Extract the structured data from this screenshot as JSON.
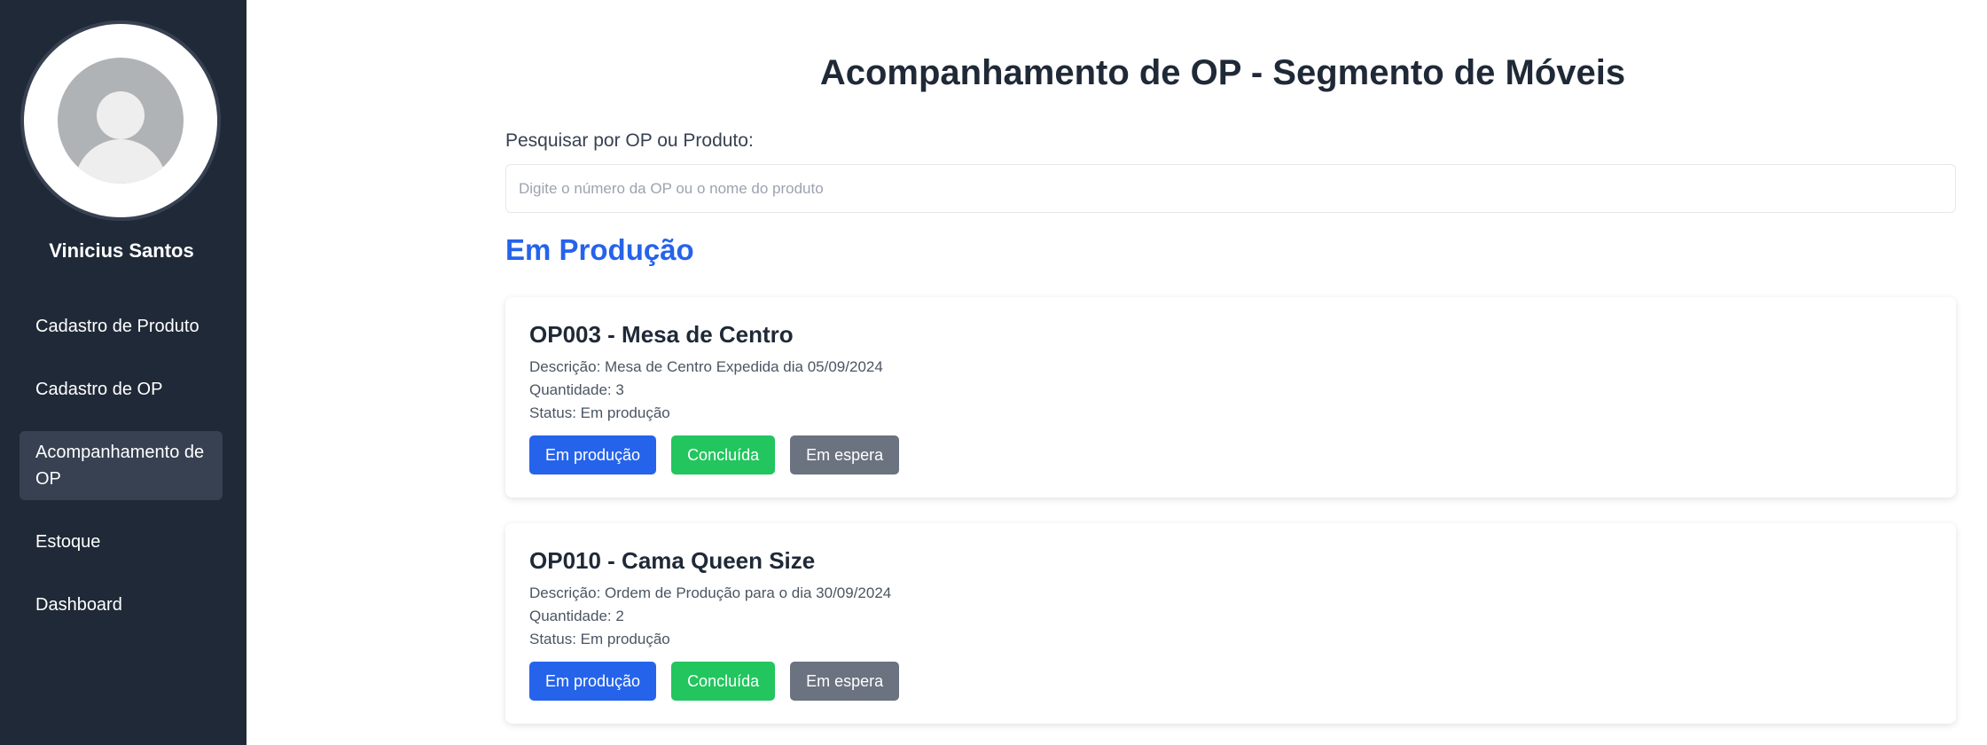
{
  "sidebar": {
    "user_name": "Vinicius Santos",
    "items": [
      {
        "label": "Cadastro de Produto",
        "active": false
      },
      {
        "label": "Cadastro de OP",
        "active": false
      },
      {
        "label": "Acompanhamento de OP",
        "active": true
      },
      {
        "label": "Estoque",
        "active": false
      },
      {
        "label": "Dashboard",
        "active": false
      }
    ]
  },
  "main": {
    "title": "Acompanhamento de OP - Segmento de Móveis",
    "search": {
      "label": "Pesquisar por OP ou Produto:",
      "placeholder": "Digite o número da OP ou o nome do produto",
      "value": ""
    },
    "section_title": "Em Produção",
    "orders": [
      {
        "title": "OP003 - Mesa de Centro",
        "description": "Descrição: Mesa de Centro Expedida dia 05/09/2024",
        "quantity": "Quantidade: 3",
        "status": "Status: Em produção",
        "buttons": [
          "Em produção",
          "Concluída",
          "Em espera"
        ]
      },
      {
        "title": "OP010 - Cama Queen Size",
        "description": "Descrição: Ordem de Produção para o dia 30/09/2024",
        "quantity": "Quantidade: 2",
        "status": "Status: Em produção",
        "buttons": [
          "Em produção",
          "Concluída",
          "Em espera"
        ]
      }
    ]
  },
  "colors": {
    "sidebar_bg": "#1f2937",
    "sidebar_active": "#374151",
    "accent_blue": "#2563eb",
    "success_green": "#22c55e",
    "neutral_gray": "#6b7280"
  },
  "icons": {
    "avatar": "user-avatar-icon"
  }
}
